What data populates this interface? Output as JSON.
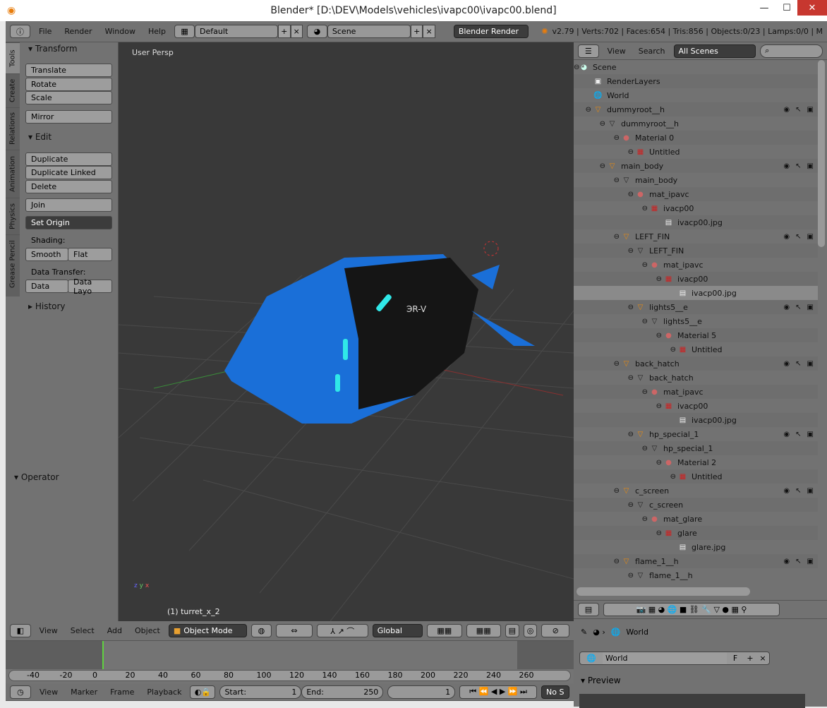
{
  "window": {
    "title": "Blender* [D:\\DEV\\Models\\vehicles\\ivapc00\\ivapc00.blend]",
    "minimize": "—",
    "maximize": "☐",
    "close": "✕"
  },
  "info_header": {
    "menus": [
      "File",
      "Render",
      "Window",
      "Help"
    ],
    "layout": "Default",
    "scene": "Scene",
    "engine": "Blender Render",
    "stats": "v2.79 | Verts:702 | Faces:654 | Tris:856 | Objects:0/23 | Lamps:0/0 | M"
  },
  "tool_tabs": [
    "Tools",
    "Create",
    "Relations",
    "Animation",
    "Physics",
    "Grease Pencil"
  ],
  "toolshelf": {
    "transform": "Transform",
    "translate": "Translate",
    "rotate": "Rotate",
    "scale": "Scale",
    "mirror": "Mirror",
    "edit": "Edit",
    "duplicate": "Duplicate",
    "duplicate_linked": "Duplicate Linked",
    "delete": "Delete",
    "join": "Join",
    "set_origin": "Set Origin",
    "shading": "Shading:",
    "smooth": "Smooth",
    "flat": "Flat",
    "data_transfer": "Data Transfer:",
    "data": "Data",
    "data_layout": "Data Layo",
    "history": "History",
    "operator": "Operator"
  },
  "viewport": {
    "label": "User Persp",
    "object_label": "(1) turret_x_2",
    "ship_text": "ЭR-V"
  },
  "view3d_header": {
    "menus": [
      "View",
      "Select",
      "Add",
      "Object"
    ],
    "mode": "Object Mode",
    "orientation": "Global"
  },
  "timeline": {
    "ticks": [
      "-40",
      "-20",
      "0",
      "20",
      "40",
      "60",
      "80",
      "100",
      "120",
      "140",
      "160",
      "180",
      "200",
      "220",
      "240",
      "260"
    ],
    "current_frame_marker": 0,
    "menus": [
      "View",
      "Marker",
      "Frame",
      "Playback"
    ],
    "start_label": "Start:",
    "start": "1",
    "end_label": "End:",
    "end": "250",
    "current": "1",
    "sync": "No S"
  },
  "outliner_header": {
    "menus": [
      "View",
      "Search"
    ],
    "filter": "All Scenes"
  },
  "outliner": [
    {
      "label": "Scene",
      "depth": 0,
      "icon": "scene"
    },
    {
      "label": "RenderLayers",
      "depth": 1,
      "icon": "renderlayers"
    },
    {
      "label": "World",
      "depth": 1,
      "icon": "world"
    },
    {
      "label": "dummyroot__h",
      "depth": 1,
      "icon": "object",
      "vis": true
    },
    {
      "label": "dummyroot__h",
      "depth": 2,
      "icon": "mesh"
    },
    {
      "label": "Material 0",
      "depth": 3,
      "icon": "material"
    },
    {
      "label": "Untitled",
      "depth": 4,
      "icon": "texture"
    },
    {
      "label": "main_body",
      "depth": 2,
      "icon": "object",
      "vis": true
    },
    {
      "label": "main_body",
      "depth": 3,
      "icon": "mesh"
    },
    {
      "label": "mat_ipavc",
      "depth": 4,
      "icon": "material"
    },
    {
      "label": "ivacp00",
      "depth": 5,
      "icon": "texture"
    },
    {
      "label": "ivacp00.jpg",
      "depth": 6,
      "icon": "image"
    },
    {
      "label": "LEFT_FIN",
      "depth": 3,
      "icon": "object",
      "vis": true
    },
    {
      "label": "LEFT_FIN",
      "depth": 4,
      "icon": "mesh"
    },
    {
      "label": "mat_ipavc",
      "depth": 5,
      "icon": "material"
    },
    {
      "label": "ivacp00",
      "depth": 6,
      "icon": "texture"
    },
    {
      "label": "ivacp00.jpg",
      "depth": 7,
      "icon": "image",
      "selected": true
    },
    {
      "label": "lights5__e",
      "depth": 4,
      "icon": "object",
      "vis": true
    },
    {
      "label": "lights5__e",
      "depth": 5,
      "icon": "mesh"
    },
    {
      "label": "Material 5",
      "depth": 6,
      "icon": "material"
    },
    {
      "label": "Untitled",
      "depth": 7,
      "icon": "texture"
    },
    {
      "label": "back_hatch",
      "depth": 3,
      "icon": "object",
      "vis": true
    },
    {
      "label": "back_hatch",
      "depth": 4,
      "icon": "mesh"
    },
    {
      "label": "mat_ipavc",
      "depth": 5,
      "icon": "material"
    },
    {
      "label": "ivacp00",
      "depth": 6,
      "icon": "texture"
    },
    {
      "label": "ivacp00.jpg",
      "depth": 7,
      "icon": "image"
    },
    {
      "label": "hp_special_1",
      "depth": 4,
      "icon": "object",
      "vis": true
    },
    {
      "label": "hp_special_1",
      "depth": 5,
      "icon": "mesh"
    },
    {
      "label": "Material 2",
      "depth": 6,
      "icon": "material"
    },
    {
      "label": "Untitled",
      "depth": 7,
      "icon": "texture"
    },
    {
      "label": "c_screen",
      "depth": 3,
      "icon": "object",
      "vis": true
    },
    {
      "label": "c_screen",
      "depth": 4,
      "icon": "mesh"
    },
    {
      "label": "mat_glare",
      "depth": 5,
      "icon": "material"
    },
    {
      "label": "glare",
      "depth": 6,
      "icon": "texture"
    },
    {
      "label": "glare.jpg",
      "depth": 7,
      "icon": "image"
    },
    {
      "label": "flame_1__h",
      "depth": 3,
      "icon": "object",
      "vis": true
    },
    {
      "label": "flame_1__h",
      "depth": 4,
      "icon": "mesh"
    }
  ],
  "properties": {
    "breadcrumb": "World",
    "world_name": "World",
    "fake_user": "F",
    "preview": "Preview"
  }
}
